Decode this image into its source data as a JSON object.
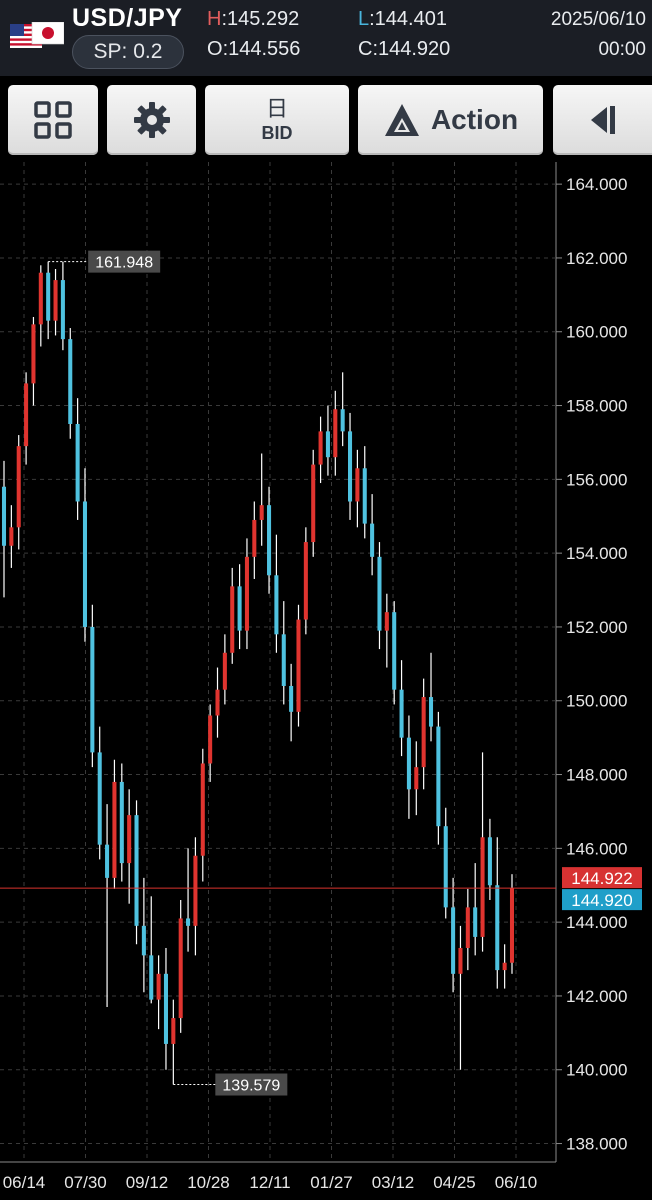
{
  "header": {
    "pair": "USD/JPY",
    "spread": "SP: 0.2",
    "high_key": "H",
    "high_val": ":145.292",
    "open_key": "O",
    "open_val": ":144.556",
    "low_key": "L",
    "low_val": ":144.401",
    "close_key": "C",
    "close_val": ":144.920",
    "date": "2025/06/10",
    "time": "00:00",
    "flags": [
      "us-flag-icon",
      "jp-flag-icon"
    ]
  },
  "toolbar": {
    "grid_icon": "grid-icon",
    "settings_icon": "gear-icon",
    "period_label": "日",
    "price_side_label": "BID",
    "action_label": "Action",
    "collapse_icon": "collapse-left-icon"
  },
  "colors": {
    "up": "#e0342f",
    "down": "#4fc2e0",
    "grid": "#3a3a3a",
    "current_line": "#d9332e",
    "bid_box": "#d73232",
    "close_box": "#1f9fc9"
  },
  "chart_data": {
    "type": "candlestick",
    "symbol": "USD/JPY",
    "timeframe": "daily",
    "ylim": [
      137.5,
      164.6
    ],
    "y_ticks": [
      "164.000",
      "162.000",
      "160.000",
      "158.000",
      "156.000",
      "154.000",
      "152.000",
      "150.000",
      "148.000",
      "146.000",
      "144.000",
      "142.000",
      "140.000",
      "138.000"
    ],
    "x_ticks": [
      "06/14",
      "07/30",
      "09/12",
      "10/28",
      "12/11",
      "01/27",
      "03/12",
      "04/25",
      "06/10"
    ],
    "annotations": {
      "high_label": "161.948",
      "low_label": "139.579"
    },
    "current_price_label": "144.922",
    "close_price_label": "144.920",
    "series": [
      {
        "values": [
          [
            155.8,
            156.5,
            152.8,
            154.2
          ],
          [
            154.2,
            155.3,
            153.6,
            154.7
          ],
          [
            154.7,
            157.2,
            154.1,
            156.9
          ],
          [
            156.9,
            158.9,
            156.4,
            158.6
          ],
          [
            158.6,
            160.4,
            158.0,
            160.2
          ],
          [
            160.2,
            161.8,
            159.6,
            161.6
          ],
          [
            161.6,
            161.9,
            159.8,
            160.3
          ],
          [
            160.3,
            161.7,
            159.9,
            161.4
          ],
          [
            161.4,
            161.9,
            159.5,
            159.8
          ],
          [
            159.8,
            160.1,
            157.1,
            157.5
          ],
          [
            157.5,
            158.2,
            154.9,
            155.4
          ],
          [
            155.4,
            156.3,
            151.6,
            152.0
          ],
          [
            152.0,
            152.6,
            148.2,
            148.6
          ],
          [
            148.6,
            149.3,
            145.7,
            146.1
          ],
          [
            146.1,
            147.2,
            141.7,
            145.2
          ],
          [
            145.2,
            148.4,
            144.9,
            147.8
          ],
          [
            147.8,
            148.3,
            145.1,
            145.6
          ],
          [
            145.6,
            147.6,
            144.5,
            146.9
          ],
          [
            146.9,
            147.3,
            143.4,
            143.9
          ],
          [
            143.9,
            145.2,
            142.1,
            143.1
          ],
          [
            143.1,
            144.7,
            141.8,
            141.9
          ],
          [
            141.9,
            143.1,
            141.1,
            142.6
          ],
          [
            142.6,
            143.3,
            140.0,
            140.7
          ],
          [
            140.7,
            141.9,
            139.6,
            141.4
          ],
          [
            141.4,
            144.6,
            141.0,
            144.1
          ],
          [
            144.1,
            146.0,
            143.2,
            143.9
          ],
          [
            143.9,
            146.3,
            143.1,
            145.8
          ],
          [
            145.8,
            148.7,
            145.1,
            148.3
          ],
          [
            148.3,
            149.9,
            147.8,
            149.6
          ],
          [
            149.6,
            150.9,
            149.0,
            150.3
          ],
          [
            150.3,
            151.8,
            149.9,
            151.3
          ],
          [
            151.3,
            153.6,
            151.0,
            153.1
          ],
          [
            153.1,
            153.7,
            151.4,
            151.9
          ],
          [
            151.9,
            154.4,
            151.4,
            153.9
          ],
          [
            153.9,
            155.4,
            153.3,
            154.9
          ],
          [
            154.9,
            156.7,
            154.2,
            155.3
          ],
          [
            155.3,
            155.8,
            152.9,
            153.4
          ],
          [
            153.4,
            154.5,
            151.3,
            151.8
          ],
          [
            151.8,
            152.7,
            149.9,
            150.4
          ],
          [
            150.4,
            151.0,
            148.9,
            149.7
          ],
          [
            149.7,
            152.6,
            149.3,
            152.2
          ],
          [
            152.2,
            154.7,
            151.8,
            154.3
          ],
          [
            154.3,
            156.8,
            153.9,
            156.4
          ],
          [
            156.4,
            157.7,
            155.9,
            157.3
          ],
          [
            157.3,
            158.0,
            156.1,
            156.6
          ],
          [
            156.6,
            158.4,
            156.1,
            157.9
          ],
          [
            157.9,
            158.9,
            156.9,
            157.3
          ],
          [
            157.3,
            157.8,
            154.9,
            155.4
          ],
          [
            155.4,
            156.8,
            154.7,
            156.3
          ],
          [
            156.3,
            156.9,
            154.4,
            154.8
          ],
          [
            154.8,
            155.6,
            153.4,
            153.9
          ],
          [
            153.9,
            154.3,
            151.4,
            151.9
          ],
          [
            151.9,
            152.9,
            150.9,
            152.4
          ],
          [
            152.4,
            152.7,
            149.9,
            150.3
          ],
          [
            150.3,
            151.1,
            148.5,
            149.0
          ],
          [
            149.0,
            149.6,
            146.8,
            147.6
          ],
          [
            147.6,
            148.9,
            146.9,
            148.2
          ],
          [
            148.2,
            150.6,
            147.6,
            150.1
          ],
          [
            150.1,
            151.3,
            148.9,
            149.3
          ],
          [
            149.3,
            149.7,
            146.1,
            146.6
          ],
          [
            146.6,
            147.1,
            144.1,
            144.4
          ],
          [
            144.4,
            145.2,
            142.1,
            142.6
          ],
          [
            142.6,
            143.9,
            140.0,
            143.3
          ],
          [
            143.3,
            144.9,
            142.7,
            144.4
          ],
          [
            144.4,
            145.6,
            143.1,
            143.6
          ],
          [
            143.6,
            148.6,
            143.2,
            146.3
          ],
          [
            146.3,
            146.8,
            144.6,
            145.0
          ],
          [
            145.0,
            146.3,
            142.2,
            142.7
          ],
          [
            142.7,
            143.4,
            142.2,
            142.9
          ],
          [
            142.9,
            145.3,
            142.6,
            144.922
          ]
        ]
      }
    ]
  }
}
